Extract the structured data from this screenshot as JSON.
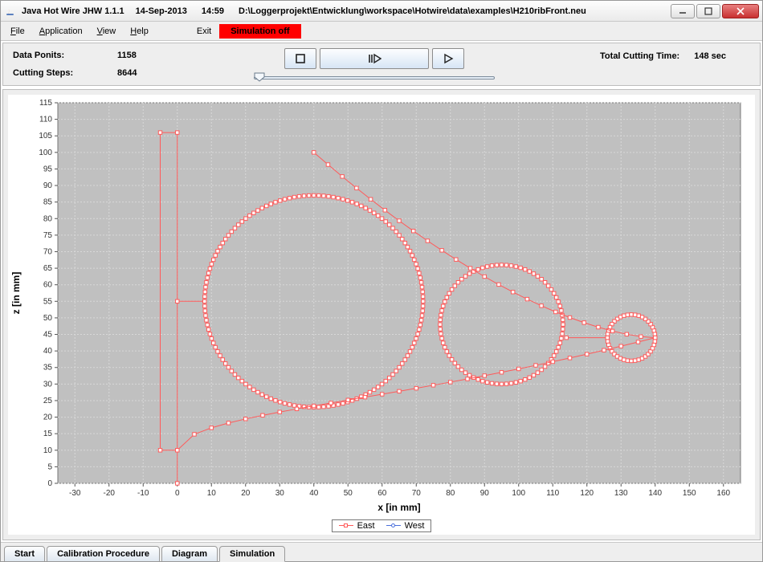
{
  "window": {
    "app_title": "Java Hot Wire JHW 1.1.1",
    "date": "14-Sep-2013",
    "time": "14:59",
    "file_path": "D:\\Loggerprojekt\\Entwicklung\\workspace\\Hotwire\\data\\examples\\H210ribFront.neu"
  },
  "menu": {
    "file": "File",
    "application": "Application",
    "view": "View",
    "help": "Help",
    "exit": "Exit",
    "sim_status": "Simulation off"
  },
  "info": {
    "data_points_label": "Data Ponits:",
    "data_points_value": "1158",
    "cutting_steps_label": "Cutting Steps:",
    "cutting_steps_value": "8644",
    "total_label": "Total Cutting Time:",
    "total_value": "148 sec"
  },
  "tabs": {
    "start": "Start",
    "calibration": "Calibration Procedure",
    "diagram": "Diagram",
    "simulation": "Simulation",
    "active": "simulation"
  },
  "chart": {
    "xlabel": "x [in mm]",
    "ylabel": "z [in mm]",
    "legend_east": "East",
    "legend_west": "West",
    "colors": {
      "east": "#ff5a5a",
      "west": "#4a6fdc",
      "plot_bg": "#c0c0c0",
      "grid": "#d8d8d8"
    }
  },
  "chart_data": {
    "type": "scatter",
    "xlabel": "x [in mm]",
    "ylabel": "z [in mm]",
    "xlim": [
      -35,
      165
    ],
    "ylim": [
      0,
      115
    ],
    "xticks": [
      -30,
      -20,
      -10,
      0,
      10,
      20,
      30,
      40,
      50,
      60,
      70,
      80,
      90,
      100,
      110,
      120,
      130,
      140,
      150,
      160
    ],
    "yticks": [
      0,
      5,
      10,
      15,
      20,
      25,
      30,
      35,
      40,
      45,
      50,
      55,
      60,
      65,
      70,
      75,
      80,
      85,
      90,
      95,
      100,
      105,
      110,
      115
    ],
    "series": [
      {
        "name": "East",
        "shape": "circle",
        "cx": 40,
        "cy": 55,
        "r": 32,
        "n": 140
      },
      {
        "name": "East",
        "shape": "circle",
        "cx": 95,
        "cy": 48,
        "r": 18,
        "n": 80
      },
      {
        "name": "East",
        "shape": "circle",
        "cx": 133,
        "cy": 44,
        "r": 7,
        "n": 40
      },
      {
        "name": "East",
        "shape": "polyline",
        "points": [
          [
            0,
            0
          ],
          [
            0,
            106
          ],
          [
            -5,
            106
          ],
          [
            -5,
            10
          ],
          [
            0,
            10
          ]
        ]
      },
      {
        "name": "East",
        "shape": "segment",
        "from": [
          0,
          55
        ],
        "to": [
          8,
          55
        ]
      },
      {
        "name": "East",
        "shape": "segment",
        "from": [
          114,
          44
        ],
        "to": [
          126,
          44
        ]
      },
      {
        "name": "East",
        "shape": "airfoil",
        "le": [
          140,
          44
        ],
        "top_start": [
          40,
          100
        ],
        "bot_start": [
          0,
          10
        ],
        "n_top": 24,
        "n_bot": 28
      }
    ]
  }
}
